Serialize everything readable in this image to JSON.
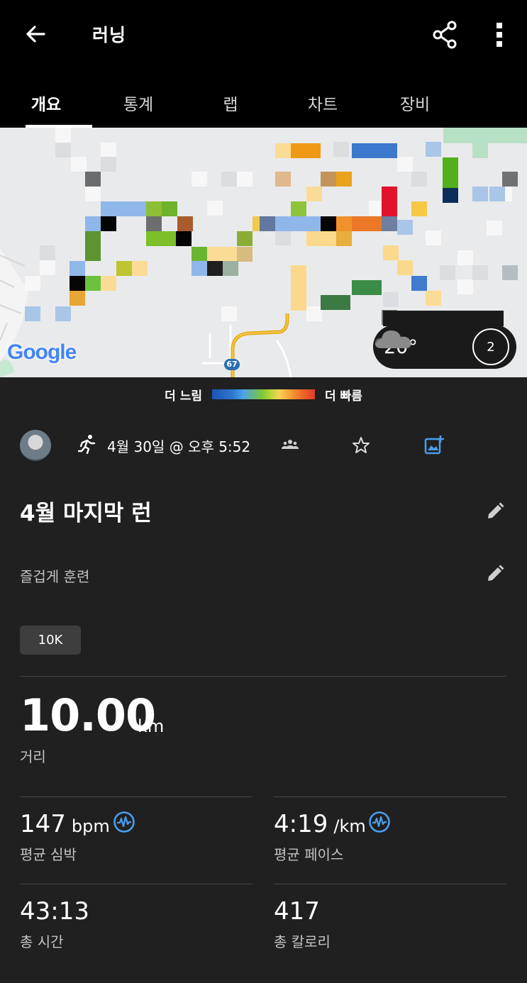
{
  "header": {
    "title": "러닝",
    "tabs": [
      {
        "label": "개요",
        "active": true
      },
      {
        "label": "통계",
        "active": false
      },
      {
        "label": "랩",
        "active": false
      },
      {
        "label": "차트",
        "active": false
      },
      {
        "label": "장비",
        "active": false
      }
    ]
  },
  "map": {
    "google_logo": "Google",
    "road_number": "67",
    "weather": {
      "temperature": "20°",
      "condition_icon": "cloud-icon",
      "wind": "2"
    }
  },
  "legend": {
    "slow": "더 느림",
    "fast": "더 빠름",
    "colors": [
      "#1a53b6",
      "#4aa3e8",
      "#7cc63a",
      "#f6d257",
      "#ee6a28",
      "#e23a2a"
    ]
  },
  "activity": {
    "date": "4월 30일 @ 오후 5:52",
    "name": "4월 마지막 런",
    "description": "즐겁게 훈련",
    "tag": "10K"
  },
  "stats": {
    "distance": {
      "value": "10.00",
      "unit": "km",
      "label": "거리"
    },
    "avg_hr": {
      "value": "147",
      "unit": "bpm",
      "label": "평균 심박"
    },
    "avg_pace": {
      "value": "4:19",
      "unit": "/km",
      "label": "평균 페이스"
    },
    "total_time": {
      "value": "43:13",
      "label": "총 시간"
    },
    "calories": {
      "value": "417",
      "label": "총 칼로리"
    }
  },
  "colors": {
    "accent": "#4a9eed",
    "background": "#202020",
    "topbar": "#000000"
  }
}
